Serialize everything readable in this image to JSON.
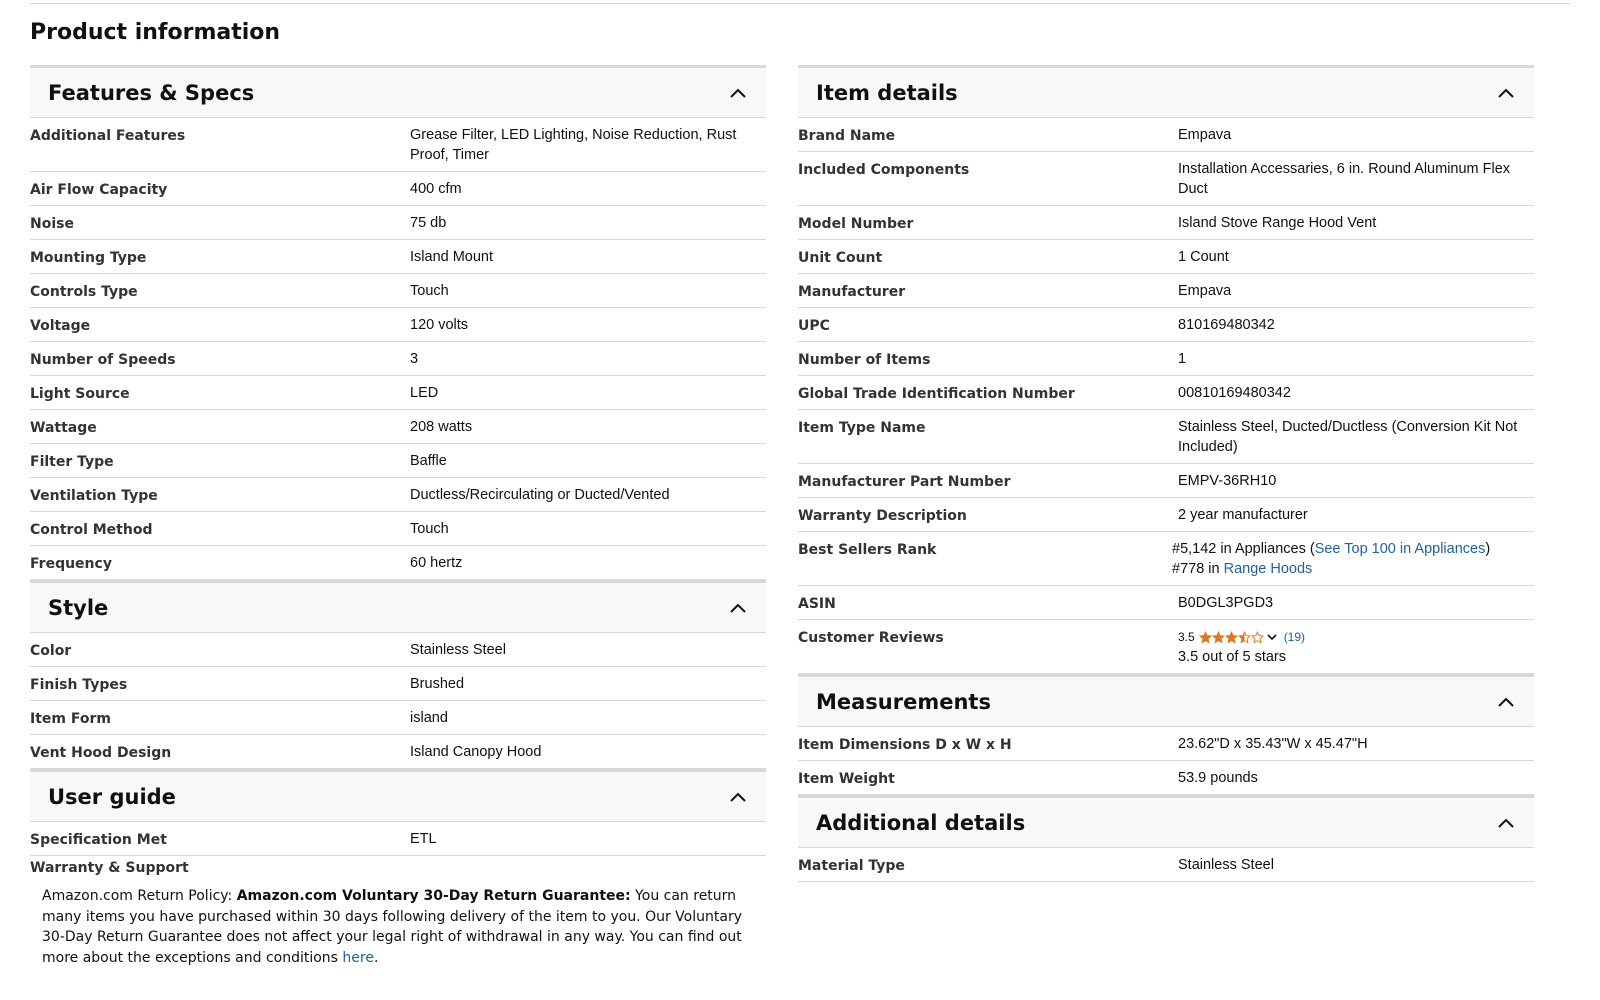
{
  "page_title": "Product information",
  "left_sections": [
    {
      "title": "Features & Specs",
      "rows": [
        {
          "label": "Additional Features",
          "value": "Grease Filter, LED Lighting, Noise Reduction, Rust Proof, Timer"
        },
        {
          "label": "Air Flow Capacity",
          "value": "400 cfm"
        },
        {
          "label": "Noise",
          "value": "75 db"
        },
        {
          "label": "Mounting Type",
          "value": "Island Mount"
        },
        {
          "label": "Controls Type",
          "value": "Touch"
        },
        {
          "label": "Voltage",
          "value": "120 volts"
        },
        {
          "label": "Number of Speeds",
          "value": "3"
        },
        {
          "label": "Light Source",
          "value": "LED"
        },
        {
          "label": "Wattage",
          "value": "208 watts"
        },
        {
          "label": "Filter Type",
          "value": "Baffle"
        },
        {
          "label": "Ventilation Type",
          "value": "Ductless/Recirculating or Ducted/Vented"
        },
        {
          "label": "Control Method",
          "value": "Touch"
        },
        {
          "label": "Frequency",
          "value": "60 hertz"
        }
      ]
    },
    {
      "title": "Style",
      "rows": [
        {
          "label": "Color",
          "value": "Stainless Steel"
        },
        {
          "label": "Finish Types",
          "value": "Brushed"
        },
        {
          "label": "Item Form",
          "value": "island"
        },
        {
          "label": "Vent Hood Design",
          "value": "Island Canopy Hood"
        }
      ]
    },
    {
      "title": "User guide",
      "rows": [
        {
          "label": "Specification Met",
          "value": "ETL"
        }
      ]
    }
  ],
  "warranty": {
    "title": "Warranty & Support",
    "prefix": "Amazon.com Return Policy: ",
    "bold": "Amazon.com Voluntary 30-Day Return Guarantee:",
    "body": " You can return many items you have purchased within 30 days following delivery of the item to you. Our Voluntary 30-Day Return Guarantee does not affect your legal right of withdrawal in any way. You can find out more about the exceptions and conditions ",
    "link": "here",
    "suffix": "."
  },
  "right_sections": [
    {
      "title": "Item details",
      "rows": [
        {
          "label": "Brand Name",
          "value": "Empava"
        },
        {
          "label": "Included Components",
          "value": "Installation Accessaries, 6 in. Round Aluminum Flex Duct"
        },
        {
          "label": "Model Number",
          "value": "Island Stove Range Hood Vent"
        },
        {
          "label": "Unit Count",
          "value": "1 Count"
        },
        {
          "label": "Manufacturer",
          "value": "Empava"
        },
        {
          "label": "UPC",
          "value": "810169480342"
        },
        {
          "label": "Number of Items",
          "value": "1"
        },
        {
          "label": "Global Trade Identification Number",
          "value": "00810169480342"
        },
        {
          "label": "Item Type Name",
          "value": "Stainless Steel, Ducted/Ductless (Conversion Kit Not Included)"
        },
        {
          "label": "Manufacturer Part Number",
          "value": "EMPV-36RH10"
        },
        {
          "label": "Warranty Description",
          "value": "2 year manufacturer"
        }
      ],
      "best_sellers": {
        "label": "Best Sellers Rank",
        "line1_prefix": "#5,142 in Appliances (",
        "line1_link": "See Top 100 in Appliances",
        "line1_suffix": ")",
        "line2_prefix": "#778 in ",
        "line2_link": "Range Hoods"
      },
      "asin": {
        "label": "ASIN",
        "value": "B0DGL3PGD3"
      },
      "reviews": {
        "label": "Customer Reviews",
        "rating": "3.5",
        "rating_value": 3.5,
        "count": "(19)",
        "summary": "3.5 out of 5 stars",
        "star_color": "#de7921"
      }
    },
    {
      "title": "Measurements",
      "rows": [
        {
          "label": "Item Dimensions D x W x H",
          "value": "23.62\"D x 35.43\"W x 45.47\"H"
        },
        {
          "label": "Item Weight",
          "value": "53.9 pounds"
        }
      ]
    },
    {
      "title": "Additional details",
      "rows": [
        {
          "label": "Material Type",
          "value": "Stainless Steel"
        }
      ]
    }
  ],
  "colors": {
    "link": "#2162a1",
    "border": "#d5d9d9",
    "header_bg": "#f7f8f8"
  },
  "icons": {
    "collapse": "chevron-up-icon",
    "star": "star-icon",
    "dropdown": "chevron-down-icon"
  }
}
